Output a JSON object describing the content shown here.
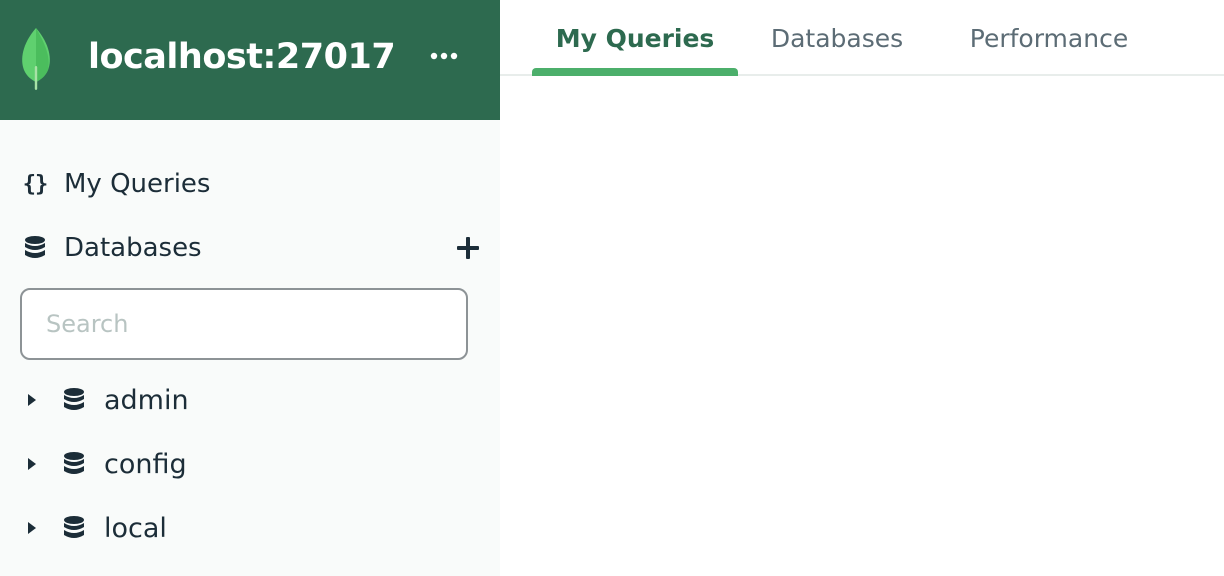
{
  "app": {
    "host": "localhost:27017",
    "brand_color": "#2d6a4f",
    "accent_color": "#4caf6b",
    "icons": {
      "logo": "leaf-icon",
      "more": "ellipsis-icon",
      "add": "plus-icon",
      "database": "database-icon",
      "queries": "braces-icon",
      "expand": "caret-right-icon"
    }
  },
  "sidebar": {
    "nav": [
      {
        "label": "My Queries"
      },
      {
        "label": "Databases"
      }
    ],
    "search": {
      "placeholder": "Search",
      "value": ""
    },
    "databases": [
      {
        "name": "admin"
      },
      {
        "name": "config"
      },
      {
        "name": "local"
      }
    ]
  },
  "tabs": [
    {
      "label": "My Queries",
      "active": true
    },
    {
      "label": "Databases",
      "active": false
    },
    {
      "label": "Performance",
      "active": false
    }
  ]
}
